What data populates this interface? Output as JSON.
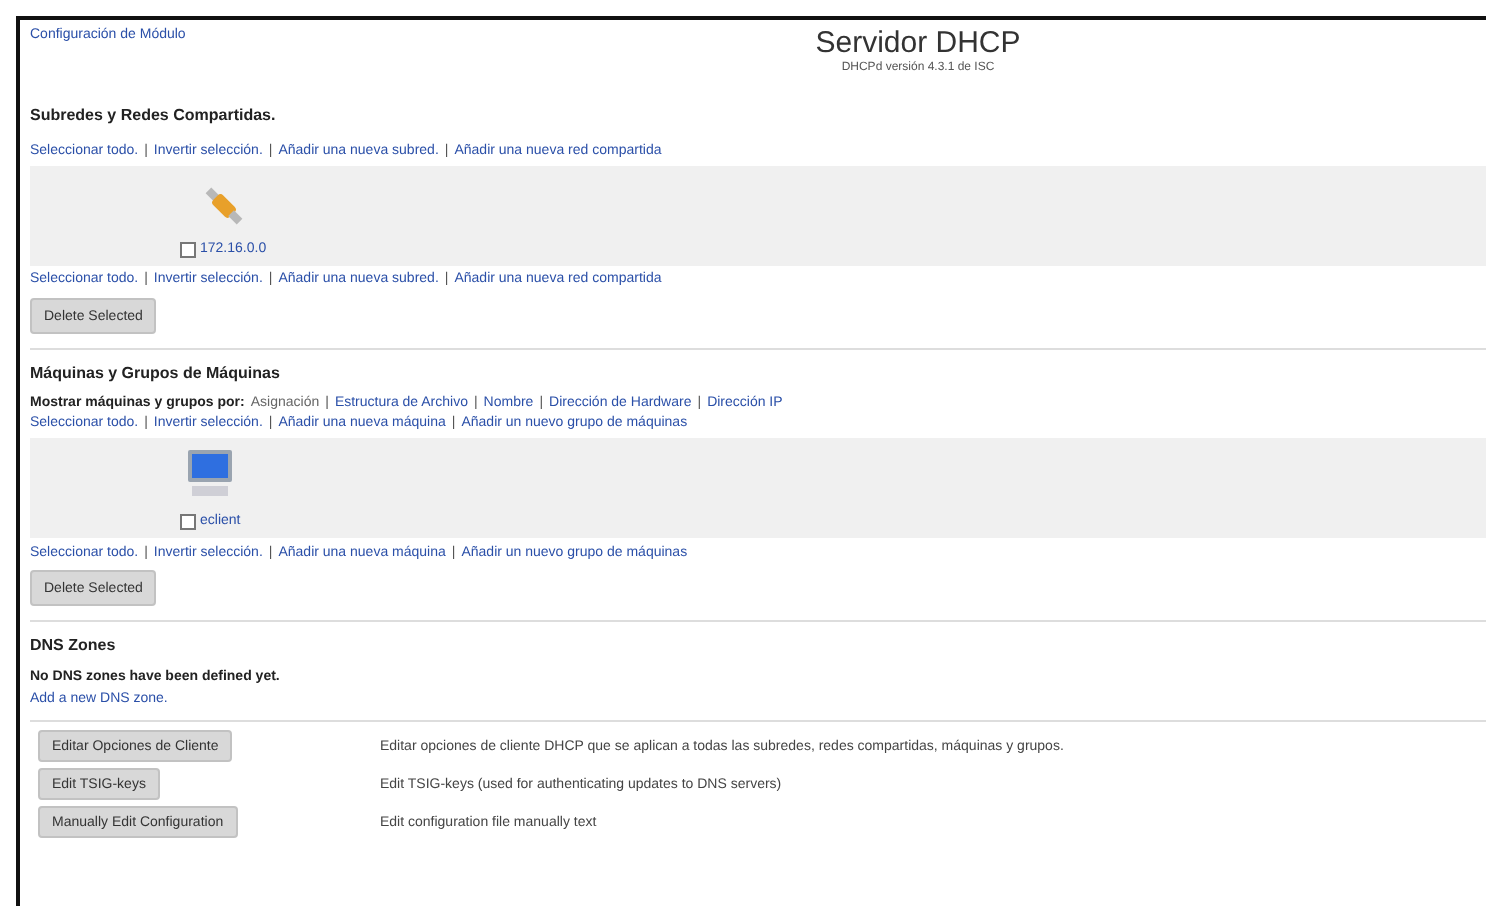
{
  "header": {
    "module_config_link": "Configuración de Módulo",
    "title": "Servidor DHCP",
    "subtitle": "DHCPd versión 4.3.1 de ISC"
  },
  "subnets": {
    "heading": "Subredes y Redes Compartidas.",
    "links_top": {
      "separator": "|",
      "items": [
        "Seleccionar todo.",
        "Invertir selección.",
        "Añadir una nueva subred.",
        "Añadir una nueva red compartida"
      ]
    },
    "items": [
      {
        "kind": "subnet",
        "label": "172.16.0.0",
        "checked": false
      }
    ],
    "links_bottom": {
      "separator": "|",
      "items": [
        "Seleccionar todo.",
        "Invertir selección.",
        "Añadir una nueva subred.",
        "Añadir una nueva red compartida"
      ]
    },
    "delete_button": "Delete Selected"
  },
  "hosts": {
    "heading": "Máquinas y Grupos de Máquinas",
    "show_by": {
      "label": "Mostrar máquinas y grupos por:",
      "separator": "|",
      "items": [
        {
          "text": "Asignación",
          "selected": true
        },
        {
          "text": "Estructura de Archivo",
          "selected": false
        },
        {
          "text": "Nombre",
          "selected": false
        },
        {
          "text": "Dirección de Hardware",
          "selected": false
        },
        {
          "text": "Dirección IP",
          "selected": false
        }
      ]
    },
    "links_top": {
      "separator": "|",
      "items": [
        "Seleccionar todo.",
        "Invertir selección.",
        "Añadir una nueva máquina",
        "Añadir un nuevo grupo de máquinas"
      ]
    },
    "items": [
      {
        "kind": "host",
        "label": "eclient",
        "checked": false
      }
    ],
    "links_bottom": {
      "separator": "|",
      "items": [
        "Seleccionar todo.",
        "Invertir selección.",
        "Añadir una nueva máquina",
        "Añadir un nuevo grupo de máquinas"
      ]
    },
    "delete_button": "Delete Selected"
  },
  "dns": {
    "heading": "DNS Zones",
    "message": "No DNS zones have been defined yet.",
    "add_link": "Add a new DNS zone."
  },
  "actions": [
    {
      "button": "Editar Opciones de Cliente",
      "description": "Editar opciones de cliente DHCP que se aplican a todas las subredes, redes compartidas, máquinas y grupos."
    },
    {
      "button": "Edit TSIG-keys",
      "description": "Edit TSIG-keys (used for authenticating updates to DNS servers)"
    },
    {
      "button": "Manually Edit Configuration",
      "description": "Edit configuration file manually text"
    }
  ]
}
